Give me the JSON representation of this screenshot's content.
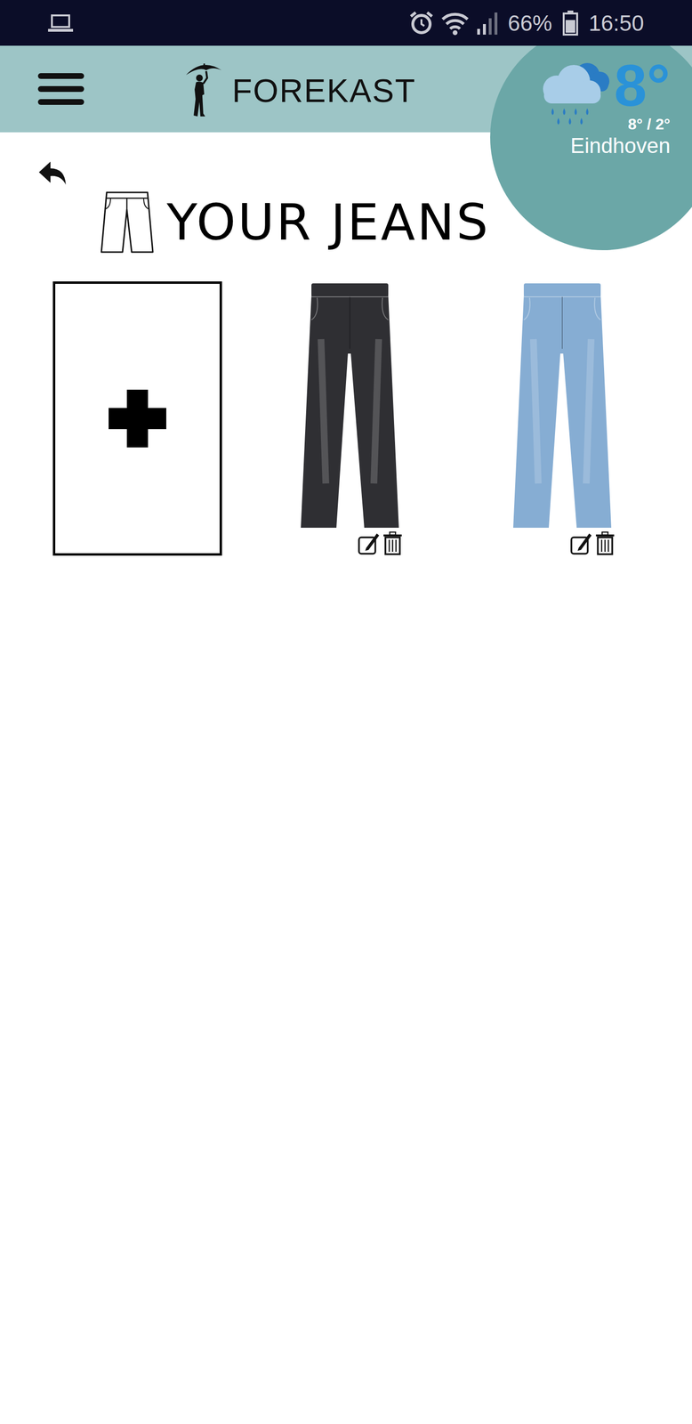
{
  "status_bar": {
    "battery": "66%",
    "battery_level": 0.66,
    "time": "16:50"
  },
  "app_bar": {
    "title": "FOREKAST"
  },
  "weather": {
    "temperature": "8°",
    "range": "8° / 2°",
    "city": "Eindhoven"
  },
  "page": {
    "title": "YOUR JEANS"
  },
  "items": [
    {
      "color": "#2f2f33"
    },
    {
      "color": "#86add3"
    }
  ]
}
